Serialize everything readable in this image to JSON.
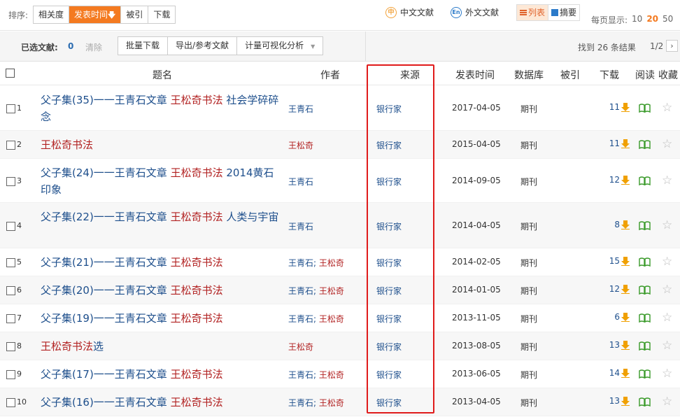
{
  "toolbar": {
    "sort_label": "排序:",
    "sort_options": [
      {
        "label": "相关度",
        "active": false
      },
      {
        "label": "发表时间",
        "active": true,
        "arrow": "🡇"
      },
      {
        "label": "被引",
        "active": false
      },
      {
        "label": "下载",
        "active": false
      }
    ],
    "lang_cn": {
      "icon": "中",
      "label": "中文文献"
    },
    "lang_en": {
      "icon": "En",
      "label": "外文文献"
    },
    "view_list": "列表",
    "view_abstract": "摘要",
    "per_page_label": "每页显示:",
    "per_page_options": [
      "10",
      "20",
      "50"
    ],
    "per_page_selected": "20"
  },
  "selection_bar": {
    "selected_label": "已选文献:",
    "selected_count": "0",
    "clear": "清除",
    "actions": [
      "批量下载",
      "导出/参考文献",
      "计量可视化分析"
    ],
    "result_count": "找到 26 条结果",
    "page": "1/2",
    "next": "›"
  },
  "table": {
    "headers": {
      "title": "题名",
      "author": "作者",
      "source": "来源",
      "date": "发表时间",
      "database": "数据库",
      "cited": "被引",
      "download": "下载",
      "read": "阅读",
      "favorite": "收藏"
    },
    "rows": [
      {
        "idx": "1",
        "title_pre": "父子集(35)一一王青石文章 ",
        "title_hl": "王松奇书法",
        "title_post": " 社会学碎碎念",
        "author": "王青石",
        "author_hl": "",
        "source": "银行家",
        "date": "2017-04-05",
        "db": "期刊",
        "downloads": "11"
      },
      {
        "idx": "2",
        "title_pre": "",
        "title_hl": "王松奇书法",
        "title_post": "",
        "author": "",
        "author_hl": "王松奇",
        "source": "银行家",
        "date": "2015-04-05",
        "db": "期刊",
        "downloads": "11"
      },
      {
        "idx": "3",
        "title_pre": "父子集(24)一一王青石文章 ",
        "title_hl": "王松奇书法",
        "title_post": " 2014黄石印象",
        "author": "王青石",
        "author_hl": "",
        "source": "银行家",
        "date": "2014-09-05",
        "db": "期刊",
        "downloads": "12"
      },
      {
        "idx": "4",
        "title_pre": "父子集(22)一一王青石文章 ",
        "title_hl": "王松奇书法",
        "title_post": " 人类与宇宙",
        "author": "王青石",
        "author_hl": "",
        "source": "银行家",
        "date": "2014-04-05",
        "db": "期刊",
        "downloads": "8"
      },
      {
        "idx": "5",
        "title_pre": "父子集(21)一一王青石文章 ",
        "title_hl": "王松奇书法",
        "title_post": "",
        "author": "王青石; ",
        "author_hl": "王松奇",
        "source": "银行家",
        "date": "2014-02-05",
        "db": "期刊",
        "downloads": "15"
      },
      {
        "idx": "6",
        "title_pre": "父子集(20)一一王青石文章 ",
        "title_hl": "王松奇书法",
        "title_post": "",
        "author": "王青石; ",
        "author_hl": "王松奇",
        "source": "银行家",
        "date": "2014-01-05",
        "db": "期刊",
        "downloads": "12"
      },
      {
        "idx": "7",
        "title_pre": "父子集(19)一一王青石文章 ",
        "title_hl": "王松奇书法",
        "title_post": "",
        "author": "王青石; ",
        "author_hl": "王松奇",
        "source": "银行家",
        "date": "2013-11-05",
        "db": "期刊",
        "downloads": "6"
      },
      {
        "idx": "8",
        "title_pre": "",
        "title_hl": "王松奇书法",
        "title_post": "选",
        "author": "",
        "author_hl": "王松奇",
        "source": "银行家",
        "date": "2013-08-05",
        "db": "期刊",
        "downloads": "13"
      },
      {
        "idx": "9",
        "title_pre": "父子集(17)一一王青石文章 ",
        "title_hl": "王松奇书法",
        "title_post": "",
        "author": "王青石; ",
        "author_hl": "王松奇",
        "source": "银行家",
        "date": "2013-06-05",
        "db": "期刊",
        "downloads": "14"
      },
      {
        "idx": "10",
        "title_pre": "父子集(16)一一王青石文章 ",
        "title_hl": "王松奇书法",
        "title_post": "",
        "author": "王青石; ",
        "author_hl": "王松奇",
        "source": "银行家",
        "date": "2013-04-05",
        "db": "期刊",
        "downloads": "13"
      }
    ]
  },
  "icons": {
    "download": "download-icon",
    "read": "book-open-icon",
    "favorite": "star-icon",
    "favorite_glyph": "☆"
  },
  "colors": {
    "accent": "#f47a20",
    "link": "#1e4f8c",
    "highlight": "#b22222",
    "annotation_box": "#e01b1b"
  }
}
